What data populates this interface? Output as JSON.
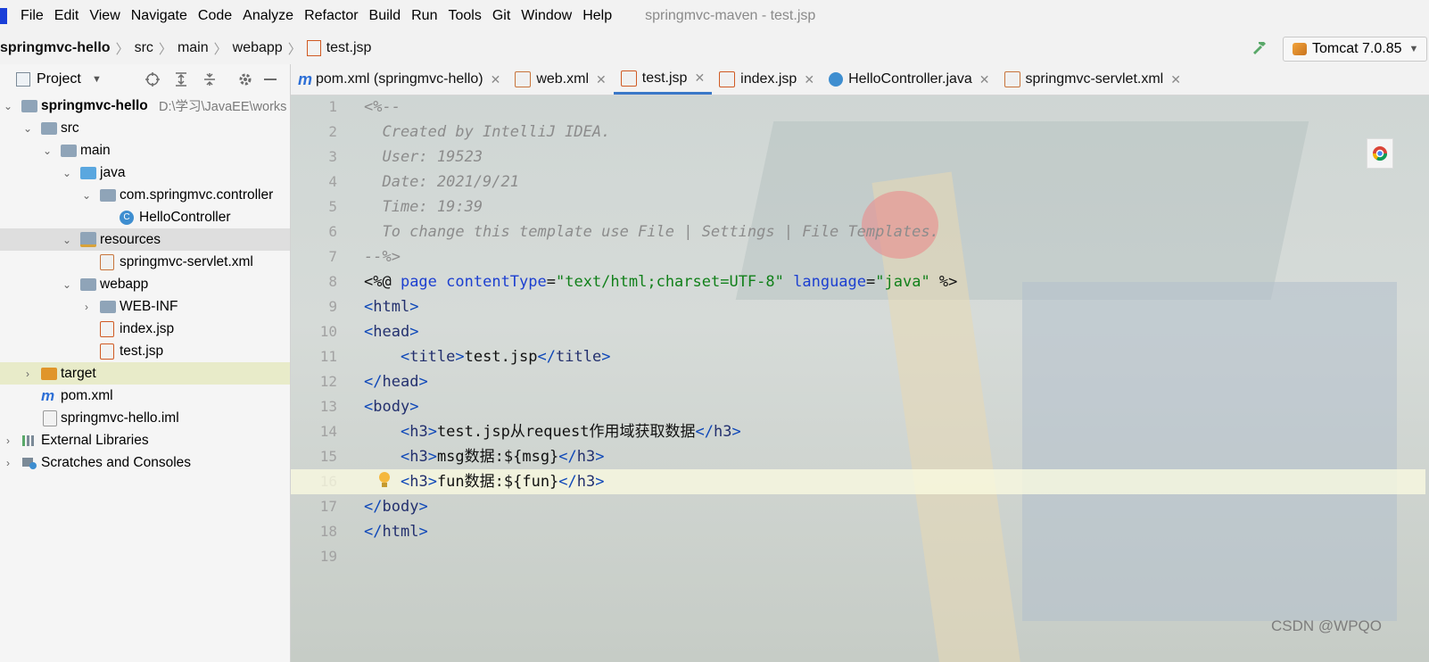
{
  "menu": {
    "items": [
      "File",
      "Edit",
      "View",
      "Navigate",
      "Code",
      "Analyze",
      "Refactor",
      "Build",
      "Run",
      "Tools",
      "Git",
      "Window",
      "Help"
    ],
    "title": "springmvc-maven - test.jsp"
  },
  "breadcrumb": [
    "springmvc-hello",
    "src",
    "main",
    "webapp",
    "test.jsp"
  ],
  "run_config": "Tomcat 7.0.85",
  "project_panel": {
    "title": "Project",
    "root_label": "springmvc-hello",
    "root_path": "D:\\学习\\JavaEE\\works",
    "items": [
      {
        "label": "src",
        "type": "folder"
      },
      {
        "label": "main",
        "type": "folder"
      },
      {
        "label": "java",
        "type": "folder-blue"
      },
      {
        "label": "com.springmvc.controller",
        "type": "package"
      },
      {
        "label": "HelloController",
        "type": "class"
      },
      {
        "label": "resources",
        "type": "resources"
      },
      {
        "label": "springmvc-servlet.xml",
        "type": "xml"
      },
      {
        "label": "webapp",
        "type": "webapp"
      },
      {
        "label": "WEB-INF",
        "type": "folder"
      },
      {
        "label": "index.jsp",
        "type": "jsp"
      },
      {
        "label": "test.jsp",
        "type": "jsp"
      },
      {
        "label": "target",
        "type": "target"
      },
      {
        "label": "pom.xml",
        "type": "maven"
      },
      {
        "label": "springmvc-hello.iml",
        "type": "iml"
      },
      {
        "label": "External Libraries",
        "type": "libs"
      },
      {
        "label": "Scratches and Consoles",
        "type": "scratch"
      }
    ]
  },
  "tabs": [
    {
      "label": "pom.xml (springmvc-hello)",
      "icon": "maven-icon",
      "active": false
    },
    {
      "label": "web.xml",
      "icon": "xml-icon",
      "active": false
    },
    {
      "label": "test.jsp",
      "icon": "jsp-icon",
      "active": true
    },
    {
      "label": "index.jsp",
      "icon": "jsp-icon",
      "active": false
    },
    {
      "label": "HelloController.java",
      "icon": "class-icon",
      "active": false
    },
    {
      "label": "springmvc-servlet.xml",
      "icon": "xml-icon",
      "active": false
    }
  ],
  "editor": {
    "line_numbers": [
      "1",
      "2",
      "3",
      "4",
      "5",
      "6",
      "7",
      "8",
      "9",
      "10",
      "11",
      "12",
      "13",
      "14",
      "15",
      "16",
      "17",
      "18",
      "19"
    ],
    "lines": [
      {
        "t": "<%--",
        "c": "cmt"
      },
      {
        "t": "  Created by IntelliJ IDEA.",
        "c": "cmt"
      },
      {
        "t": "  User: 19523",
        "c": "cmt"
      },
      {
        "t": "  Date: 2021/9/21",
        "c": "cmt"
      },
      {
        "t": "  Time: 19:39",
        "c": "cmt"
      },
      {
        "t": "  To change this template use File | Settings | File Templates.",
        "c": "cmt"
      },
      {
        "t": "--%>",
        "c": "cmt"
      },
      {
        "t": "<%@ page contentType=\"text/html;charset=UTF-8\" language=\"java\" %>",
        "c": "dir"
      },
      {
        "t": "<html>",
        "c": "tag"
      },
      {
        "t": "<head>",
        "c": "tag"
      },
      {
        "t": "    <title>test.jsp</title>",
        "c": "tag"
      },
      {
        "t": "</head>",
        "c": "tag"
      },
      {
        "t": "<body>",
        "c": "tag"
      },
      {
        "t": "    <h3>test.jsp从request作用域获取数据</h3>",
        "c": "tag"
      },
      {
        "t": "    <h3>msg数据:${msg}</h3>",
        "c": "tag"
      },
      {
        "t": "    <h3>fun数据:${fun}</h3>",
        "c": "tag"
      },
      {
        "t": "</body>",
        "c": "tag"
      },
      {
        "t": "</html>",
        "c": "tag"
      },
      {
        "t": "",
        "c": "plain"
      }
    ]
  },
  "watermark": "CSDN @WPQO",
  "colors": {
    "accent": "#3a78c8",
    "tag": "#0d47b8",
    "string": "#11801a",
    "comment": "#8c8c8c"
  }
}
